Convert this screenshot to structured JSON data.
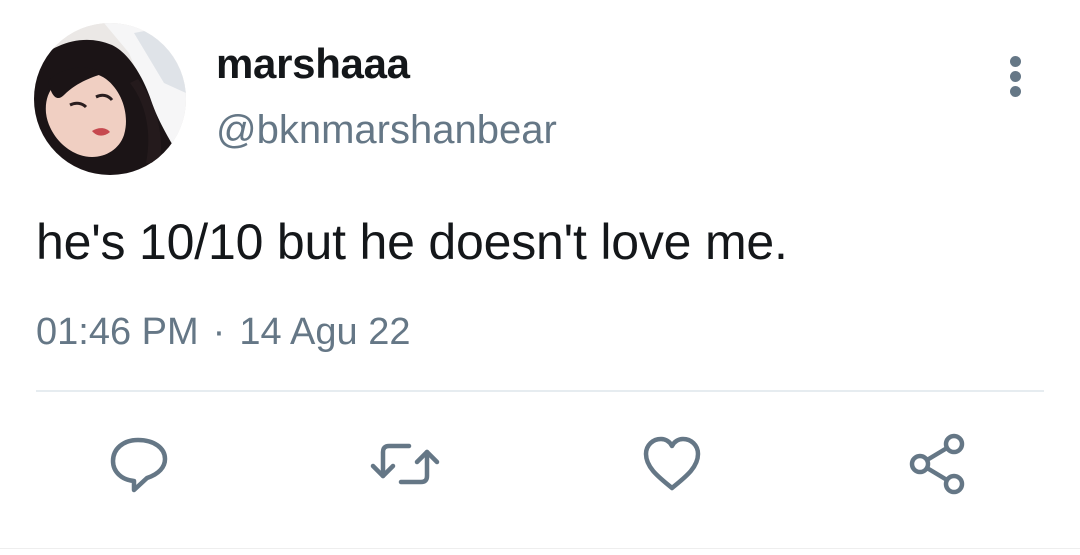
{
  "user": {
    "display_name": "marshaaa",
    "handle": "@bknmarshanbear"
  },
  "tweet": {
    "text": "he's 10/10 but he doesn't love me.",
    "time": "01:46 PM",
    "separator": "·",
    "date": "14 Agu 22"
  },
  "icons": {
    "more": "more-vertical-icon",
    "reply": "reply-bubble-icon",
    "retweet": "retweet-icon",
    "like": "heart-icon",
    "share": "share-icon"
  },
  "colors": {
    "text": "#14171a",
    "secondary": "#657786",
    "divider": "#e6ecf0",
    "background": "#ffffff"
  }
}
